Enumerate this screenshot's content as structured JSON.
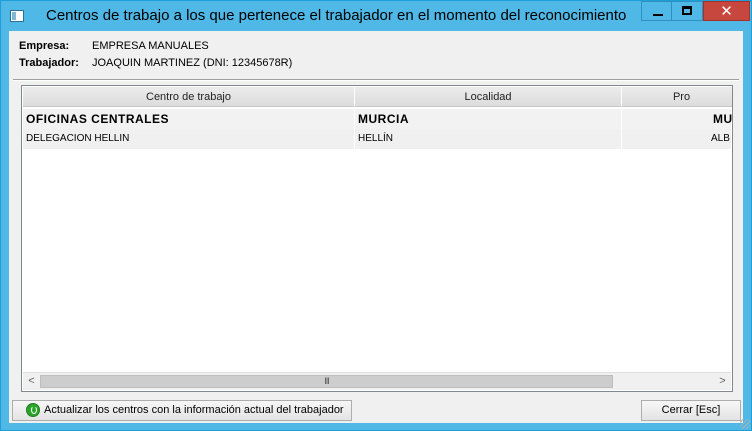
{
  "window": {
    "title": "Centros de trabajo a los que pertenece el trabajador en el momento del reconocimiento",
    "close_glyph": "✕"
  },
  "info": {
    "empresa_label": "Empresa:",
    "empresa_value": "EMPRESA MANUALES",
    "trabajador_label": "Trabajador:",
    "trabajador_value": "JOAQUIN MARTINEZ (DNI: 12345678R)"
  },
  "grid": {
    "columns": [
      "Centro de trabajo",
      "Localidad",
      "Pro"
    ],
    "rows": [
      [
        "OFICINAS CENTRALES",
        "MURCIA",
        "MU"
      ],
      [
        "DELEGACION HELLIN",
        "HELLÍN",
        "ALB"
      ]
    ],
    "scroll_left": "<",
    "scroll_right": ">",
    "scroll_thumb": "III"
  },
  "buttons": {
    "refresh_label": "Actualizar los centros con la información actual del trabajador",
    "close_label": "Cerrar  [Esc]"
  },
  "colors": {
    "titlebar": "#4fb8e6",
    "close_button": "#c7463d",
    "refresh_icon": "#2aa52a"
  }
}
